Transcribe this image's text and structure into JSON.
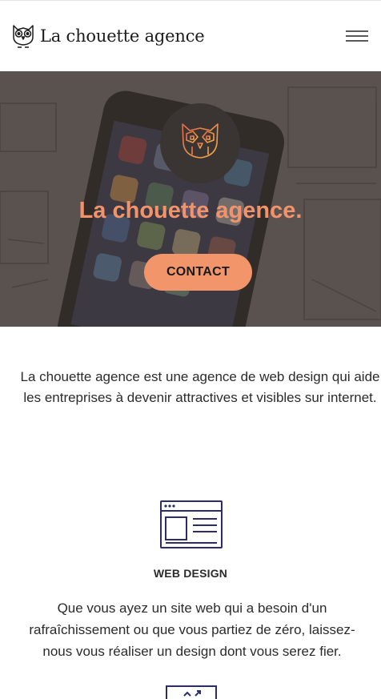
{
  "header": {
    "brand_name": "La chouette agence",
    "logo_icon": "owl-icon",
    "menu_icon": "hamburger-menu-icon"
  },
  "hero": {
    "title": "La chouette agence.",
    "logo_icon": "owl-icon",
    "contact_label": "CONTACT",
    "accent_color": "#f2956b"
  },
  "intro": {
    "line1": "La chouette agence est une agence de web design qui aide",
    "line2": "les entreprises à devenir attractives et visibles sur internet."
  },
  "services": [
    {
      "icon": "web-design-icon",
      "title": "WEB DESIGN",
      "text": "Que vous ayez un site web qui a besoin d'un rafraîchissement ou que vous partiez de zéro, laissez-nous vous réaliser un design dont vous serez fier."
    },
    {
      "icon": "next-service-icon"
    }
  ]
}
